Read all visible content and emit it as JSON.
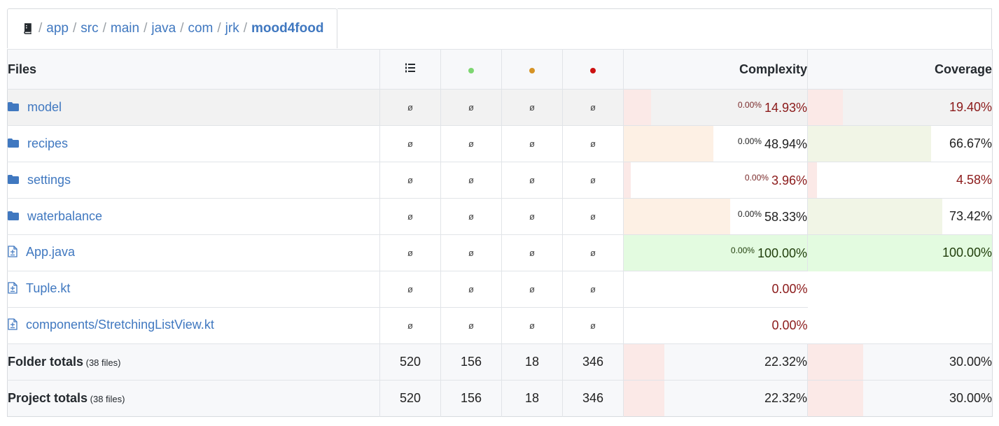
{
  "breadcrumb": {
    "items": [
      "app",
      "src",
      "main",
      "java",
      "com",
      "jrk"
    ],
    "current": "mood4food",
    "separator": "/"
  },
  "headers": {
    "files": "Files",
    "complexity": "Complexity",
    "coverage": "Coverage",
    "icons": [
      "lines-icon",
      "green-dot-icon",
      "orange-dot-icon",
      "red-dot-icon"
    ]
  },
  "colors": {
    "green_dot": "#7dd671",
    "orange_dot": "#d69325",
    "red_dot": "#cc1111",
    "link": "#4078c0"
  },
  "rows": [
    {
      "name": "model",
      "type": "folder",
      "values": [
        "ø",
        "ø",
        "ø",
        "ø"
      ],
      "complexity_small": "0.00%",
      "complexity": "14.93%",
      "complexity_fill": 0.15,
      "coverage": "19.40%",
      "coverage_fill": 0.19
    },
    {
      "name": "recipes",
      "type": "folder",
      "values": [
        "ø",
        "ø",
        "ø",
        "ø"
      ],
      "complexity_small": "0.00%",
      "complexity": "48.94%",
      "complexity_fill": 0.49,
      "coverage": "66.67%",
      "coverage_fill": 0.67
    },
    {
      "name": "settings",
      "type": "folder",
      "values": [
        "ø",
        "ø",
        "ø",
        "ø"
      ],
      "complexity_small": "0.00%",
      "complexity": "3.96%",
      "complexity_fill": 0.04,
      "coverage": "4.58%",
      "coverage_fill": 0.05
    },
    {
      "name": "waterbalance",
      "type": "folder",
      "values": [
        "ø",
        "ø",
        "ø",
        "ø"
      ],
      "complexity_small": "0.00%",
      "complexity": "58.33%",
      "complexity_fill": 0.58,
      "coverage": "73.42%",
      "coverage_fill": 0.73
    },
    {
      "name": "App.java",
      "type": "file",
      "values": [
        "ø",
        "ø",
        "ø",
        "ø"
      ],
      "complexity_small": "0.00%",
      "complexity": "100.00%",
      "complexity_fill": 1.0,
      "coverage": "100.00%",
      "coverage_fill": 1.0
    },
    {
      "name": "Tuple.kt",
      "type": "file",
      "values": [
        "ø",
        "ø",
        "ø",
        "ø"
      ],
      "complexity_small": "",
      "complexity": "0.00%",
      "complexity_fill": 0,
      "coverage": "",
      "coverage_fill": 0
    },
    {
      "name": "components/StretchingListView.kt",
      "type": "file",
      "values": [
        "ø",
        "ø",
        "ø",
        "ø"
      ],
      "complexity_small": "",
      "complexity": "0.00%",
      "complexity_fill": 0,
      "coverage": "",
      "coverage_fill": 0
    }
  ],
  "totals": [
    {
      "label": "Folder totals",
      "count": "(38 files)",
      "values": [
        "520",
        "156",
        "18",
        "346"
      ],
      "complexity": "22.32%",
      "complexity_fill": 0.22,
      "coverage": "30.00%",
      "coverage_fill": 0.3
    },
    {
      "label": "Project totals",
      "count": "(38 files)",
      "values": [
        "520",
        "156",
        "18",
        "346"
      ],
      "complexity": "22.32%",
      "complexity_fill": 0.22,
      "coverage": "30.00%",
      "coverage_fill": 0.3
    }
  ]
}
